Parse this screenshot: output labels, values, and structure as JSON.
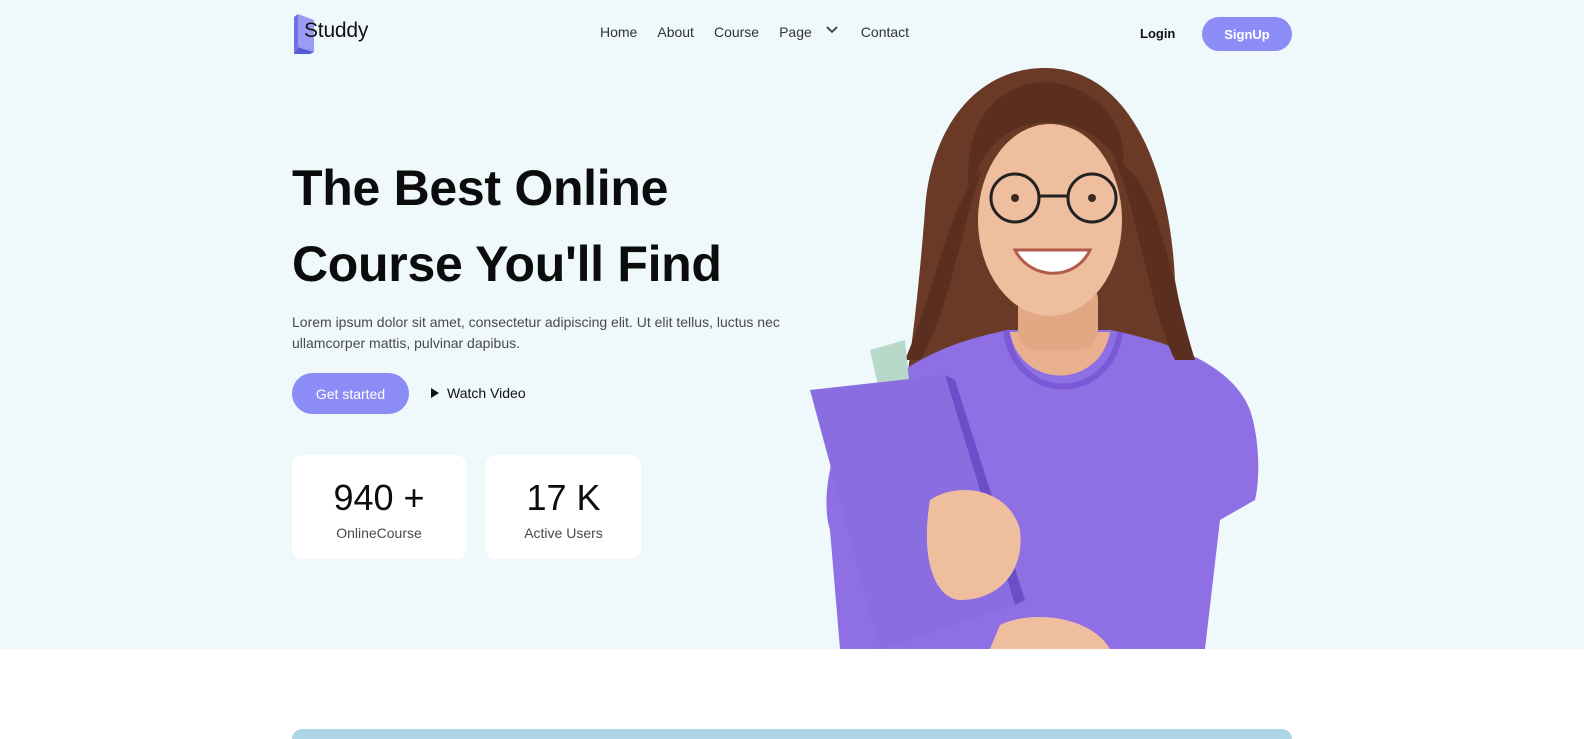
{
  "brand": {
    "name": "Studdy",
    "accent": "#8b8cf6"
  },
  "nav": {
    "links": [
      "Home",
      "About",
      "Course",
      "Page",
      "Contact"
    ],
    "login_label": "Login",
    "signup_label": "SignUp"
  },
  "hero": {
    "headline_line1": "The Best Online",
    "headline_line2": "Course You'll Find",
    "subtitle": "Lorem ipsum dolor sit amet, consectetur adipiscing elit. Ut elit tellus, luctus nec ullamcorper mattis, pulvinar dapibus.",
    "cta_label": "Get started",
    "watch_label": "Watch Video",
    "stats": [
      {
        "value": "940 +",
        "label": "OnlineCourse"
      },
      {
        "value": "17 K",
        "label": "Active Users"
      }
    ],
    "background": "#eff8fb"
  }
}
